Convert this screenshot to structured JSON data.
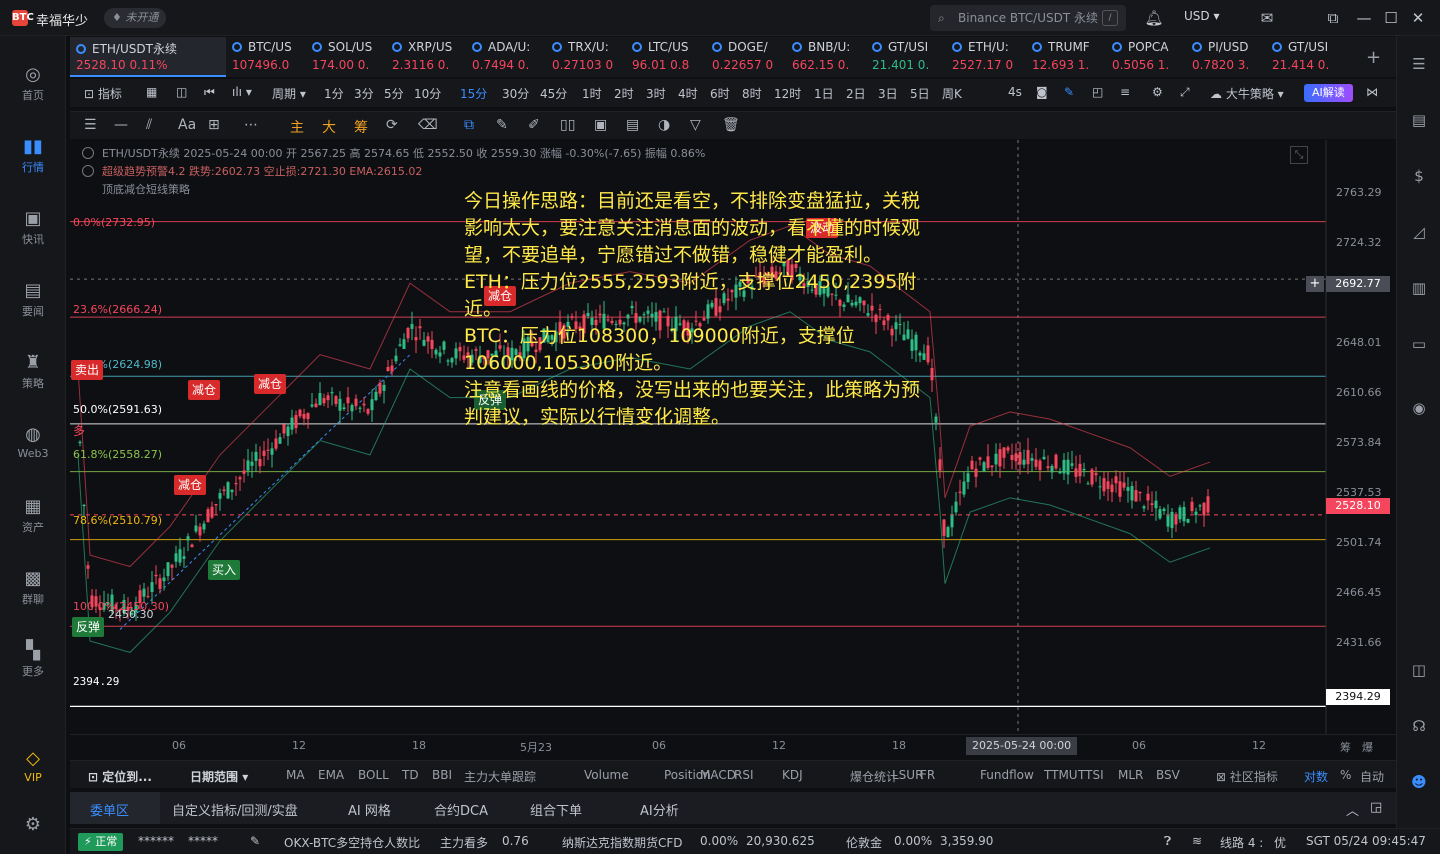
{
  "app": {
    "logo": "BTC",
    "user": "幸福华少",
    "status": "未开通"
  },
  "search": {
    "placeholder": "Binance BTC/USDT 永续",
    "shortcut": "/"
  },
  "currency": "USD",
  "left_nav": [
    {
      "label": "首页",
      "icon": "home-icon"
    },
    {
      "label": "行情",
      "icon": "market-icon",
      "active": true
    },
    {
      "label": "快讯",
      "icon": "flash-news-icon"
    },
    {
      "label": "要闻",
      "icon": "news-icon"
    },
    {
      "label": "策略",
      "icon": "strategy-icon"
    },
    {
      "label": "Web3",
      "icon": "web3-icon"
    },
    {
      "label": "资产",
      "icon": "wallet-icon"
    },
    {
      "label": "群聊",
      "icon": "chat-icon"
    },
    {
      "label": "更多",
      "icon": "more-icon"
    }
  ],
  "vip": "VIP",
  "tickers": [
    {
      "name": "ETH/USDT永续",
      "value": "2528.10 0.11%",
      "dir": "dn",
      "active": true
    },
    {
      "name": "BTC/US",
      "value": "107496.0",
      "dir": "dn"
    },
    {
      "name": "SOL/US",
      "value": "174.00 0.",
      "dir": "dn"
    },
    {
      "name": "XRP/US",
      "value": "2.3116 0.",
      "dir": "dn"
    },
    {
      "name": "ADA/U:",
      "value": "0.7494 0.",
      "dir": "dn"
    },
    {
      "name": "TRX/U:",
      "value": "0.27103 0",
      "dir": "dn"
    },
    {
      "name": "LTC/US",
      "value": "96.01 0.8",
      "dir": "dn"
    },
    {
      "name": "DOGE/",
      "value": "0.22657 0",
      "dir": "dn"
    },
    {
      "name": "BNB/U:",
      "value": "662.15 0.",
      "dir": "dn"
    },
    {
      "name": "GT/USI",
      "value": "21.401 0.",
      "dir": "up"
    },
    {
      "name": "ETH/U:",
      "value": "2527.17 0",
      "dir": "dn"
    },
    {
      "name": "TRUMF",
      "value": "12.693 1.",
      "dir": "dn"
    },
    {
      "name": "POPCA",
      "value": "0.5056 1.",
      "dir": "dn"
    },
    {
      "name": "PI/USD",
      "value": "0.7820 3.",
      "dir": "dn"
    },
    {
      "name": "GT/USI",
      "value": "21.414 0.",
      "dir": "dn"
    }
  ],
  "timeframes": {
    "indicator": "指标",
    "period": "周期",
    "items": [
      "1分",
      "3分",
      "5分",
      "10分",
      "15分",
      "30分",
      "45分",
      "1时",
      "2时",
      "3时",
      "4时",
      "6时",
      "8时",
      "12时",
      "1日",
      "2日",
      "3日",
      "5日",
      "周K"
    ],
    "active": "15分",
    "seconds": "4s",
    "strategy": "大牛策略",
    "ai": "AI解读"
  },
  "draw_tools": {
    "text": "Aa",
    "main": "主",
    "big": "大",
    "chip": "筹"
  },
  "chart_info": {
    "line1": "ETH/USDT永续  2025-05-24 00:00  开 2567.25  高 2574.65  低 2552.50  收 2559.30  涨幅 -0.30%(-7.65)  振幅 0.86%",
    "line2": "超级趋势预警4.2  跌势:2602.73  空止损:2721.30  EMA:2615.02",
    "line3": "顶底减仓短线策略"
  },
  "y_labels": [
    "2763.29",
    "2724.32",
    "2692.77",
    "2648.01",
    "2610.66",
    "2573.84",
    "2537.53",
    "2528.10",
    "2501.74",
    "2466.45",
    "2431.66",
    "2394.29"
  ],
  "current_price": "2528.10",
  "cursor_price": "2692.77",
  "low_price_label": "2394.29",
  "fib_levels": [
    {
      "label": "0.0%(2732.95)",
      "color": "#f6465d"
    },
    {
      "label": "23.6%(2666.24)",
      "color": "#f6465d"
    },
    {
      "label": "38.2%(2624.98)",
      "color": "#4fb8c9"
    },
    {
      "label": "50.0%(2591.63)",
      "color": "#ffffff"
    },
    {
      "label": "61.8%(2558.27)",
      "color": "#8bc34a"
    },
    {
      "label": "78.6%(2510.79)",
      "color": "#f0b90b"
    },
    {
      "label": "100.0%(2450.30)",
      "color": "#f6465d"
    }
  ],
  "low_marker": "2450.30",
  "tags": {
    "sell": "卖出",
    "reduce": "减仓",
    "buy": "买入",
    "rebound": "反弹",
    "fluct": "波动",
    "long": "多"
  },
  "note": [
    "今日操作思路：目前还是看空，不排除变盘猛拉，关税影响太大，要注意关注消息面的波动，看不懂的时候观望，不要追单，宁愿错过不做错，稳健才能盈利。",
    "ETH：压力位2555,2593附近，支撑位2450,2395附近。",
    "BTC：压力位108300，109000附近，支撑位106000,105300附近。",
    "注意看画线的价格，没写出来的也要关注，此策略为预判建议，实际以行情变化调整。"
  ],
  "x_labels": [
    "06",
    "12",
    "18",
    "5月23",
    "06",
    "12",
    "18",
    "06",
    "12"
  ],
  "x_cursor": "2025-05-24 00:00",
  "x_right": [
    "筹",
    "爆"
  ],
  "indicators": {
    "locate": "定位到...",
    "range": "日期范围",
    "items": [
      "MA",
      "EMA",
      "BOLL",
      "TD",
      "BBI",
      "主力大单跟踪",
      "Volume",
      "Position",
      "MACD",
      "RSI",
      "KDJ",
      "爆仓统计",
      "LSUR",
      "FR",
      "Fundflow",
      "TTMU",
      "TTSI",
      "MLR",
      "BSV"
    ],
    "community": "社区指标",
    "log": "对数",
    "pct": "%",
    "auto": "自动"
  },
  "bottom_tabs": [
    {
      "label": "委单区",
      "active": true
    },
    {
      "label": "自定义指标/回测/实盘"
    },
    {
      "label": "AI 网格"
    },
    {
      "label": "合约DCA"
    },
    {
      "label": "组合下单"
    },
    {
      "label": "AI分析"
    }
  ],
  "status": {
    "normal": "正常",
    "mask1": "******",
    "mask2": "*****",
    "okx_label": "OKX-BTC多空持仓人数比",
    "okx_state": "主力看多",
    "okx_value": "0.76",
    "nasdaq_label": "纳斯达克指数期货CFD",
    "nasdaq_pct": "0.00%",
    "nasdaq_value": "20,930.625",
    "gold_label": "伦敦金",
    "gold_pct": "0.00%",
    "gold_value": "3,359.90",
    "line_label": "线路 4 :",
    "line_quality": "优",
    "clock": "SGT 05/24 09:45:47"
  },
  "colors": {
    "up": "#2ebd85",
    "down": "#f6465d",
    "accent": "#3a8dff",
    "note": "#ffe94a"
  }
}
